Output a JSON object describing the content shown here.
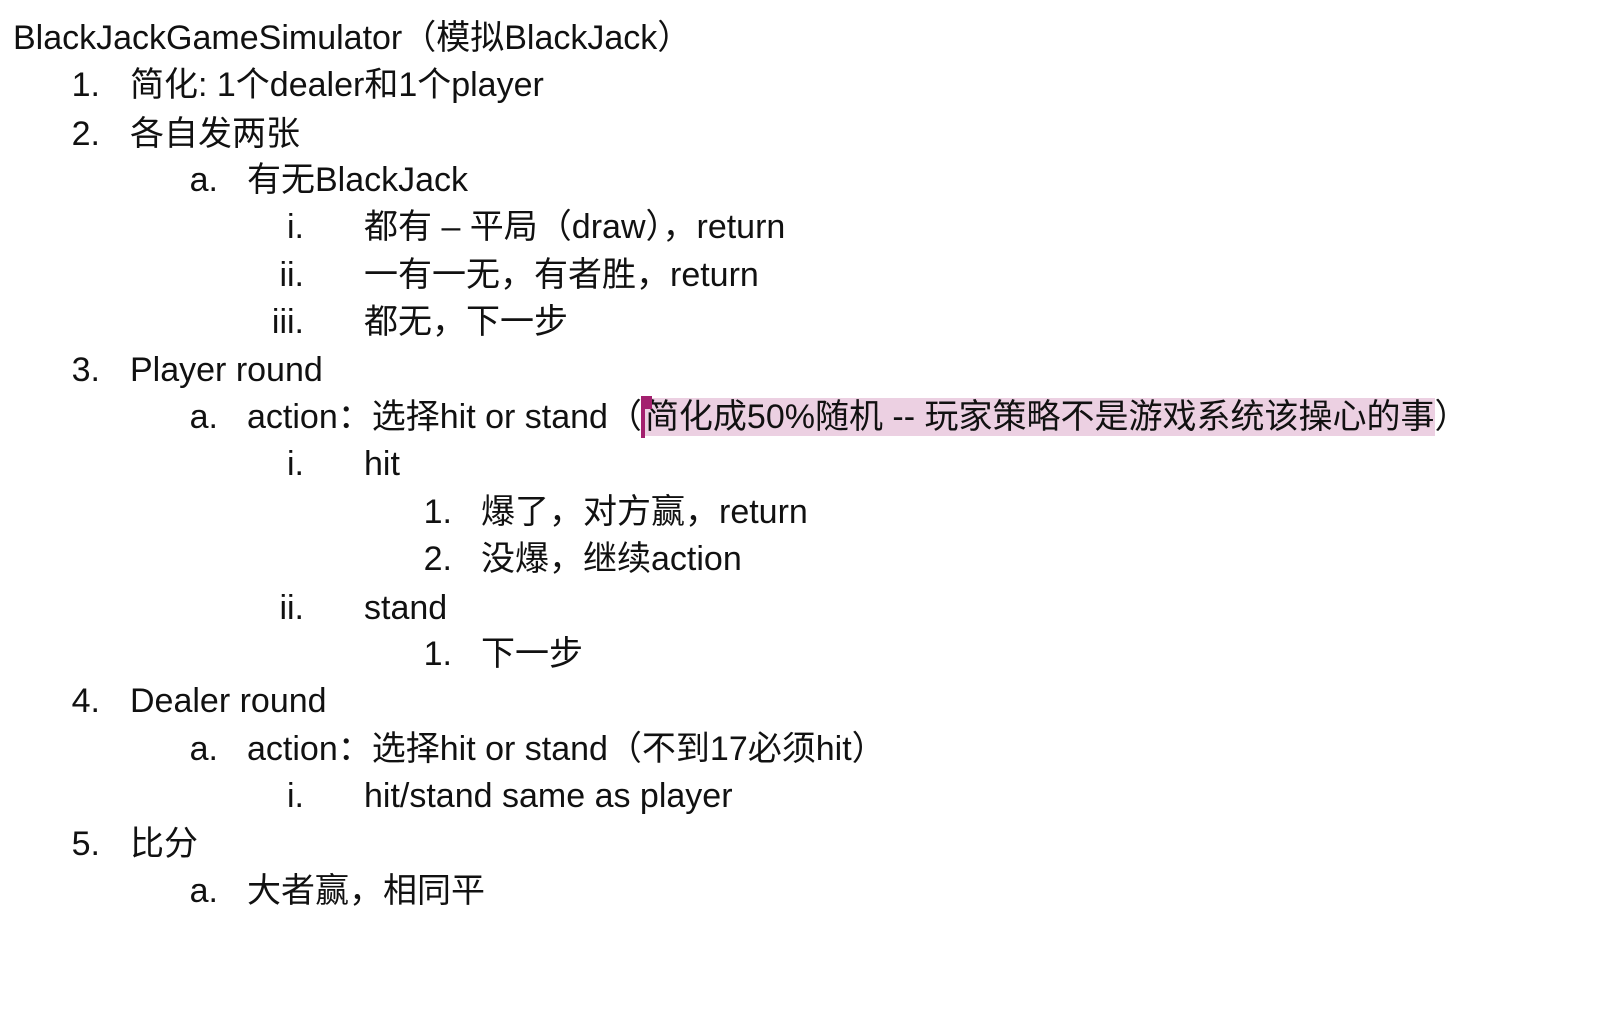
{
  "document": {
    "title": "BlackJackGameSimulator（模拟BlackJack）",
    "items": [
      {
        "marker": "1.",
        "text": "简化: 1个dealer和1个player"
      },
      {
        "marker": "2.",
        "text": "各自发两张"
      },
      {
        "marker": "a.",
        "text": "有无BlackJack"
      },
      {
        "marker": "i.",
        "text": "都有 – 平局（draw），return"
      },
      {
        "marker": "ii.",
        "text": "一有一无，有者胜，return"
      },
      {
        "marker": "iii.",
        "text": "都无，下一步"
      },
      {
        "marker": "3.",
        "text": "Player round"
      },
      {
        "marker": "a.",
        "text_before": "action：选择hit or stand（",
        "text_highlight": "简化成50%随机 -- 玩家策略不是游戏系统该操心的事",
        "text_after": "）"
      },
      {
        "marker": "i.",
        "text": "hit"
      },
      {
        "marker": "1.",
        "text": "爆了，对方赢，return"
      },
      {
        "marker": "2.",
        "text": "没爆，继续action"
      },
      {
        "marker": "ii.",
        "text": "stand"
      },
      {
        "marker": "1.",
        "text": "下一步"
      },
      {
        "marker": "4.",
        "text": "Dealer round"
      },
      {
        "marker": "a.",
        "text": "action：选择hit or stand（不到17必须hit）"
      },
      {
        "marker": "i.",
        "text": "hit/stand same as player"
      },
      {
        "marker": "5.",
        "text": "比分"
      },
      {
        "marker": "a.",
        "text": "大者赢，相同平"
      }
    ]
  },
  "colors": {
    "text": "#111111",
    "highlight": "#ecd0e2",
    "cursor": "#a3206e"
  }
}
